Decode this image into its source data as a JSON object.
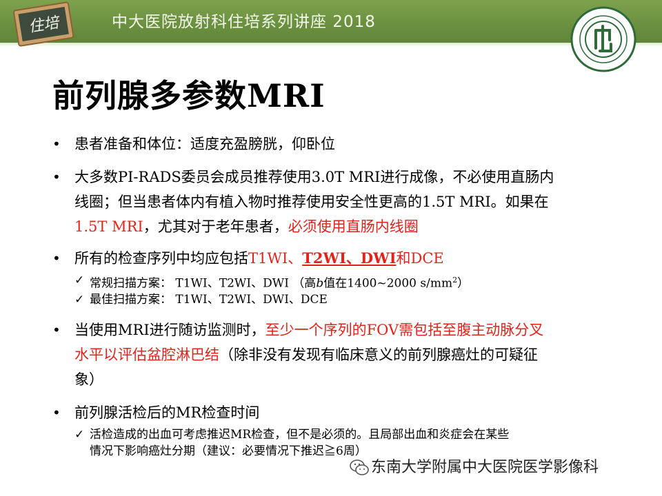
{
  "header": {
    "tag": "住培",
    "title": "中大医院放射科住培系列讲座 2018"
  },
  "slide": {
    "title": "前列腺多参数MRI",
    "items": [
      {
        "text": "患者准备和体位：适度充盈膀胱，仰卧位"
      },
      {
        "line1": "大多数PI-RADS委员会成员推荐使用3.0T MRI进行成像，不必使用直肠内",
        "line2": "线圈；但当患者体内有植入物时推荐使用安全性更高的1.5T MRI。如果在",
        "line3_red1": "1.5T MRI",
        "line3_mid": "，尤其对于老年患者，",
        "line3_red2": "必须使用直肠内线圈"
      },
      {
        "pre": "所有的检查序列中均应包括",
        "t1": "T1WI、",
        "t2dwi": "T2WI、DWI",
        "and": "和",
        "dce": "DCE",
        "sub1_pre": "常规扫描方案：  T1WI、T2WI、DWI （高",
        "sub1_b": "b",
        "sub1_mid": "值在1400~2000 s/mm",
        "sub1_sup": "2",
        "sub1_end": "）",
        "sub2": "最佳扫描方案：  T1WI、T2WI、DWI、DCE"
      },
      {
        "pre": "当使用MRI进行随访监测时，",
        "red": "至少一个序列的FOV需包括至腹主动脉分叉",
        "line2_red": "水平以评估盆腔淋巴结",
        "line2_rest": "（除非没有发现有临床意义的前列腺癌灶的可疑征",
        "line3": "象）"
      },
      {
        "text": "前列腺活检后的MR检查时间",
        "sub1": "活检造成的出血可考虑推迟MR检查，但不是必须的。且局部出血和炎症会在某些",
        "sub2": "情况下影响癌灶分期（建议：必要情况下推迟≧6周）"
      }
    ]
  },
  "watermark": "东南大学附属中大医院医学影像科"
}
